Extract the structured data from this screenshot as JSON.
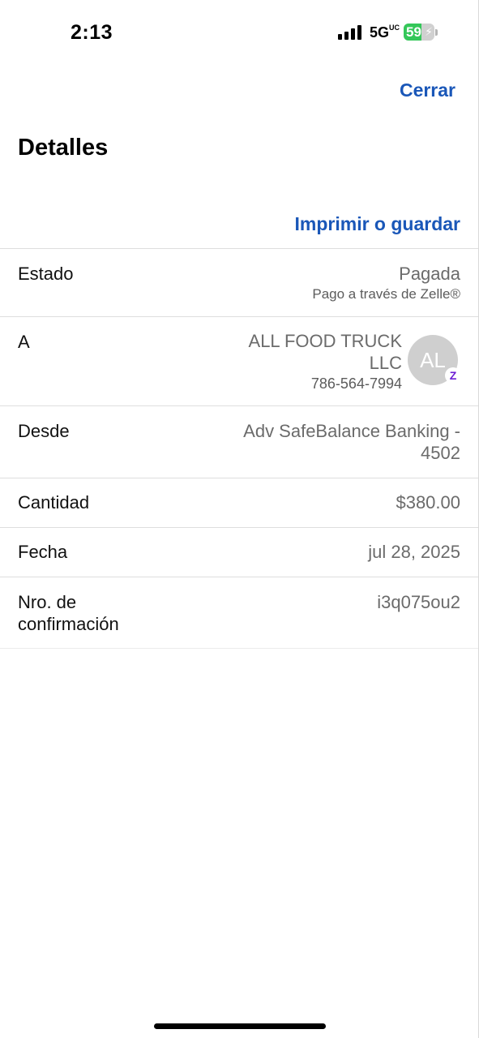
{
  "status_bar": {
    "time": "2:13",
    "network": "5G",
    "network_sup": "UC",
    "battery_percent": "59",
    "battery_level": 0.59,
    "battery_color": "#34c759"
  },
  "header": {
    "close_label": "Cerrar",
    "title": "Detalles",
    "print_label": "Imprimir o guardar"
  },
  "details": {
    "status": {
      "label": "Estado",
      "value": "Pagada",
      "sub": "Pago a través de Zelle®"
    },
    "to": {
      "label": "A",
      "name_line1": "ALL FOOD TRUCK",
      "name_line2": "LLC",
      "phone": "786-564-7994",
      "avatar_initials": "AL",
      "badge": "Z"
    },
    "from": {
      "label": "Desde",
      "value_line1": "Adv SafeBalance Banking -",
      "value_line2": "4502"
    },
    "amount": {
      "label": "Cantidad",
      "value": "$380.00"
    },
    "date": {
      "label": "Fecha",
      "value": "jul 28, 2025"
    },
    "confirmation": {
      "label_line1": "Nro. de",
      "label_line2": "confirmación",
      "value": "i3q075ou2"
    }
  },
  "colors": {
    "link": "#1a57b8",
    "zelle": "#6d1ed4"
  }
}
